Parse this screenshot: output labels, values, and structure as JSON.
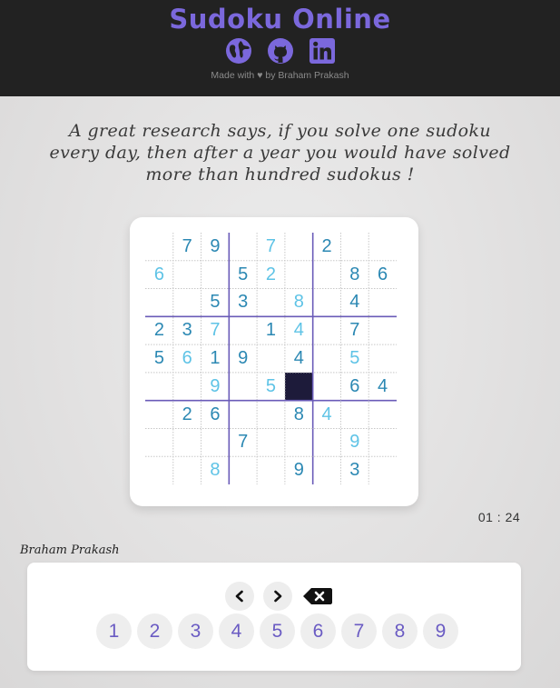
{
  "header": {
    "title": "Sudoku Online",
    "icons": [
      "globe-icon",
      "github-icon",
      "linkedin-icon"
    ],
    "made_with_prefix": "Made with",
    "made_with_suffix": "by Braham Prakash"
  },
  "quote": {
    "line1": "A great research says, if you solve one sudoku",
    "line2": "every day, then after a year you would have solved",
    "line3": "more than hundred sudokus !"
  },
  "board": {
    "selected": [
      5,
      5
    ],
    "rows": [
      [
        {
          "v": ""
        },
        {
          "v": "7",
          "t": "g"
        },
        {
          "v": "9",
          "t": "g"
        },
        {
          "v": ""
        },
        {
          "v": "7",
          "t": "u"
        },
        {
          "v": ""
        },
        {
          "v": "2",
          "t": "g"
        },
        {
          "v": ""
        },
        {
          "v": ""
        }
      ],
      [
        {
          "v": "6",
          "t": "u"
        },
        {
          "v": ""
        },
        {
          "v": ""
        },
        {
          "v": "5",
          "t": "g"
        },
        {
          "v": "2",
          "t": "u"
        },
        {
          "v": ""
        },
        {
          "v": ""
        },
        {
          "v": "8",
          "t": "g"
        },
        {
          "v": "6",
          "t": "g"
        }
      ],
      [
        {
          "v": ""
        },
        {
          "v": ""
        },
        {
          "v": "5",
          "t": "g"
        },
        {
          "v": "3",
          "t": "g"
        },
        {
          "v": ""
        },
        {
          "v": "8",
          "t": "u"
        },
        {
          "v": ""
        },
        {
          "v": "4",
          "t": "g"
        },
        {
          "v": ""
        }
      ],
      [
        {
          "v": "2",
          "t": "g"
        },
        {
          "v": "3",
          "t": "g"
        },
        {
          "v": "7",
          "t": "u"
        },
        {
          "v": ""
        },
        {
          "v": "1",
          "t": "g"
        },
        {
          "v": "4",
          "t": "u"
        },
        {
          "v": ""
        },
        {
          "v": "7",
          "t": "g"
        },
        {
          "v": ""
        }
      ],
      [
        {
          "v": "5",
          "t": "g"
        },
        {
          "v": "6",
          "t": "u"
        },
        {
          "v": "1",
          "t": "g"
        },
        {
          "v": "9",
          "t": "g"
        },
        {
          "v": ""
        },
        {
          "v": "4",
          "t": "g"
        },
        {
          "v": ""
        },
        {
          "v": "5",
          "t": "u"
        },
        {
          "v": ""
        }
      ],
      [
        {
          "v": ""
        },
        {
          "v": ""
        },
        {
          "v": "9",
          "t": "u"
        },
        {
          "v": ""
        },
        {
          "v": "5",
          "t": "u"
        },
        {
          "v": ""
        },
        {
          "v": ""
        },
        {
          "v": "6",
          "t": "g"
        },
        {
          "v": "4",
          "t": "g"
        }
      ],
      [
        {
          "v": ""
        },
        {
          "v": "2",
          "t": "g"
        },
        {
          "v": "6",
          "t": "g"
        },
        {
          "v": ""
        },
        {
          "v": ""
        },
        {
          "v": "8",
          "t": "g"
        },
        {
          "v": "4",
          "t": "u"
        },
        {
          "v": ""
        },
        {
          "v": ""
        }
      ],
      [
        {
          "v": ""
        },
        {
          "v": ""
        },
        {
          "v": ""
        },
        {
          "v": "7",
          "t": "g"
        },
        {
          "v": ""
        },
        {
          "v": ""
        },
        {
          "v": ""
        },
        {
          "v": "9",
          "t": "u"
        },
        {
          "v": ""
        }
      ],
      [
        {
          "v": ""
        },
        {
          "v": ""
        },
        {
          "v": "8",
          "t": "u"
        },
        {
          "v": ""
        },
        {
          "v": ""
        },
        {
          "v": "9",
          "t": "g"
        },
        {
          "v": ""
        },
        {
          "v": "3",
          "t": "g"
        },
        {
          "v": ""
        }
      ]
    ]
  },
  "timer": "01 : 24",
  "author": "Braham Prakash",
  "controls": {
    "nav_icons": [
      "chevron-left-icon",
      "chevron-right-icon",
      "backspace-icon"
    ],
    "numbers": [
      "1",
      "2",
      "3",
      "4",
      "5",
      "6",
      "7",
      "8",
      "9"
    ]
  },
  "colors": {
    "header_bg": "#222222",
    "title": "#7b68dc",
    "given_digit": "#2b88b3",
    "user_digit": "#5ec3e6",
    "selected_cell": "#1d1b3a",
    "box_line": "#6a5bb8",
    "number_button_text": "#6a5bc3"
  }
}
